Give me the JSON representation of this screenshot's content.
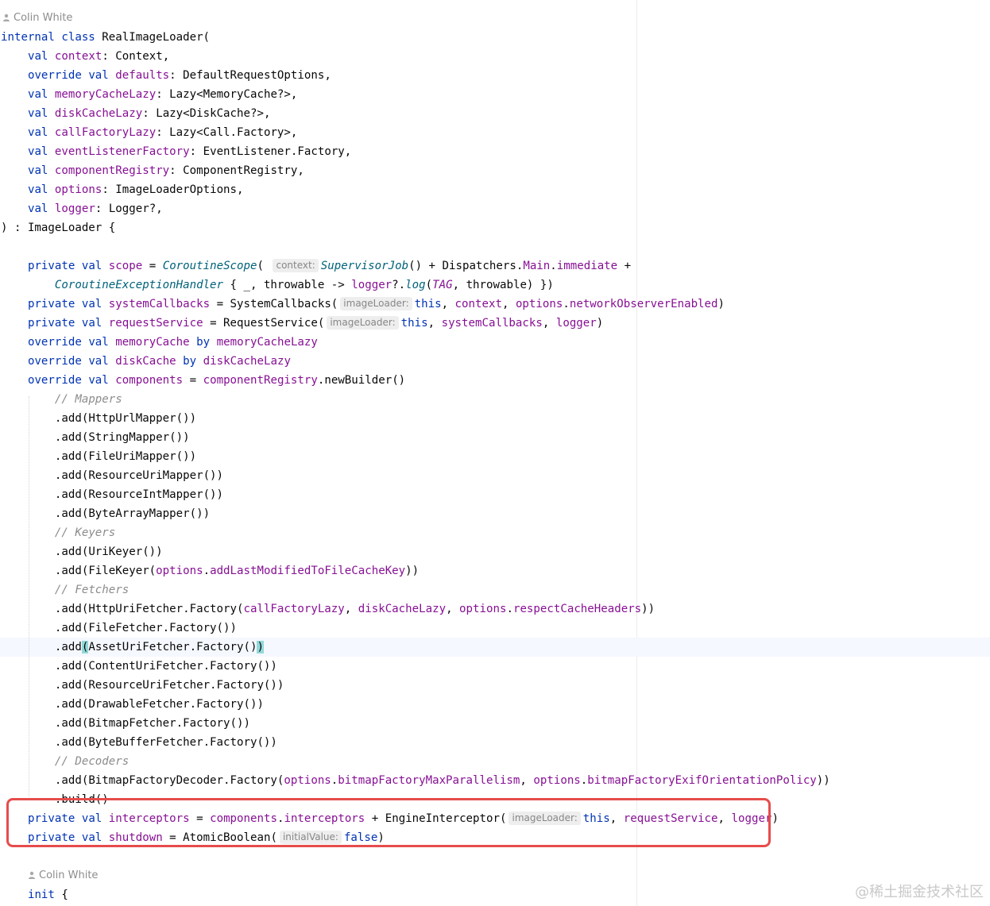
{
  "annotations": {
    "author_top": "Colin White",
    "author_bottom": "Colin White"
  },
  "hints": {
    "context": "context:",
    "imageLoader": "imageLoader:",
    "initialValue": "initialValue:"
  },
  "code": {
    "l1": [
      "internal class",
      " RealImageLoader("
    ],
    "l2": [
      "val",
      " ",
      "context",
      ": Context,"
    ],
    "l3": [
      "override val",
      " ",
      "defaults",
      ": DefaultRequestOptions,"
    ],
    "l4": [
      "val",
      " ",
      "memoryCacheLazy",
      ": Lazy<MemoryCache?>,"
    ],
    "l5": [
      "val",
      " ",
      "diskCacheLazy",
      ": Lazy<DiskCache?>,"
    ],
    "l6": [
      "val",
      " ",
      "callFactoryLazy",
      ": Lazy<Call.Factory>,"
    ],
    "l7": [
      "val",
      " ",
      "eventListenerFactory",
      ": EventListener.Factory,"
    ],
    "l8": [
      "val",
      " ",
      "componentRegistry",
      ": ComponentRegistry,"
    ],
    "l9": [
      "val",
      " ",
      "options",
      ": ImageLoaderOptions,"
    ],
    "l10": [
      "val",
      " ",
      "logger",
      ": Logger?,"
    ],
    "l11": [
      ") : ImageLoader {"
    ],
    "l12": [
      "private val",
      " ",
      "scope",
      " = ",
      "CoroutineScope",
      "( ",
      "SupervisorJob",
      "() + Dispatchers.",
      "Main",
      ".",
      "immediate",
      " +"
    ],
    "l13": [
      "CoroutineExceptionHandler",
      " { _, throwable -> ",
      "logger",
      "?.",
      "log",
      "(",
      "TAG",
      ", throwable) })"
    ],
    "l14": [
      "private val",
      " ",
      "systemCallbacks",
      " = SystemCallbacks(",
      "this",
      ", ",
      "context",
      ", ",
      "options",
      ".",
      "networkObserverEnabled",
      ")"
    ],
    "l15": [
      "private val",
      " ",
      "requestService",
      " = RequestService(",
      "this",
      ", ",
      "systemCallbacks",
      ", ",
      "logger",
      ")"
    ],
    "l16": [
      "override val",
      " ",
      "memoryCache",
      " ",
      "by",
      " ",
      "memoryCacheLazy"
    ],
    "l17": [
      "override val",
      " ",
      "diskCache",
      " ",
      "by",
      " ",
      "diskCacheLazy"
    ],
    "l18": [
      "override val",
      " ",
      "components",
      " = ",
      "componentRegistry",
      ".newBuilder()"
    ],
    "l19": [
      "// Mappers"
    ],
    "l20": [
      ".add(HttpUrlMapper())"
    ],
    "l21": [
      ".add(StringMapper())"
    ],
    "l22": [
      ".add(FileUriMapper())"
    ],
    "l23": [
      ".add(ResourceUriMapper())"
    ],
    "l24": [
      ".add(ResourceIntMapper())"
    ],
    "l25": [
      ".add(ByteArrayMapper())"
    ],
    "l26": [
      "// Keyers"
    ],
    "l27": [
      ".add(UriKeyer())"
    ],
    "l28": [
      ".add(FileKeyer(",
      "options",
      ".",
      "addLastModifiedToFileCacheKey",
      "))"
    ],
    "l29": [
      "// Fetchers"
    ],
    "l30": [
      ".add(HttpUriFetcher.Factory(",
      "callFactoryLazy",
      ", ",
      "diskCacheLazy",
      ", ",
      "options",
      ".",
      "respectCacheHeaders",
      "))"
    ],
    "l31": [
      ".add(FileFetcher.Factory())"
    ],
    "l32": [
      ".add",
      "(",
      "AssetUriFetcher.Factory()",
      ")"
    ],
    "l33": [
      ".add(ContentUriFetcher.Factory())"
    ],
    "l34": [
      ".add(ResourceUriFetcher.Factory())"
    ],
    "l35": [
      ".add(DrawableFetcher.Factory())"
    ],
    "l36": [
      ".add(BitmapFetcher.Factory())"
    ],
    "l37": [
      ".add(ByteBufferFetcher.Factory())"
    ],
    "l38": [
      "// Decoders"
    ],
    "l39": [
      ".add(BitmapFactoryDecoder.Factory(",
      "options",
      ".",
      "bitmapFactoryMaxParallelism",
      ", ",
      "options",
      ".",
      "bitmapFactoryExifOrientationPolicy",
      "))"
    ],
    "l40": [
      ".build()"
    ],
    "l41": [
      "private val",
      " ",
      "interceptors",
      " = ",
      "components",
      ".",
      "interceptors",
      " + EngineInterceptor(",
      "this",
      ", ",
      "requestService",
      ", ",
      "logger",
      ")"
    ],
    "l42": [
      "private val",
      " ",
      "shutdown",
      " = AtomicBoolean(",
      "false",
      ")"
    ],
    "l43": [
      "init",
      " {"
    ]
  },
  "watermark": "@稀土掘金技术社区",
  "colors": {
    "keyword": "#0033b3",
    "property": "#871094",
    "function_italic": "#00627a",
    "comment": "#8c8c8c",
    "highlight_box": "#e74c4c",
    "bracket_match": "#93d9d9"
  }
}
